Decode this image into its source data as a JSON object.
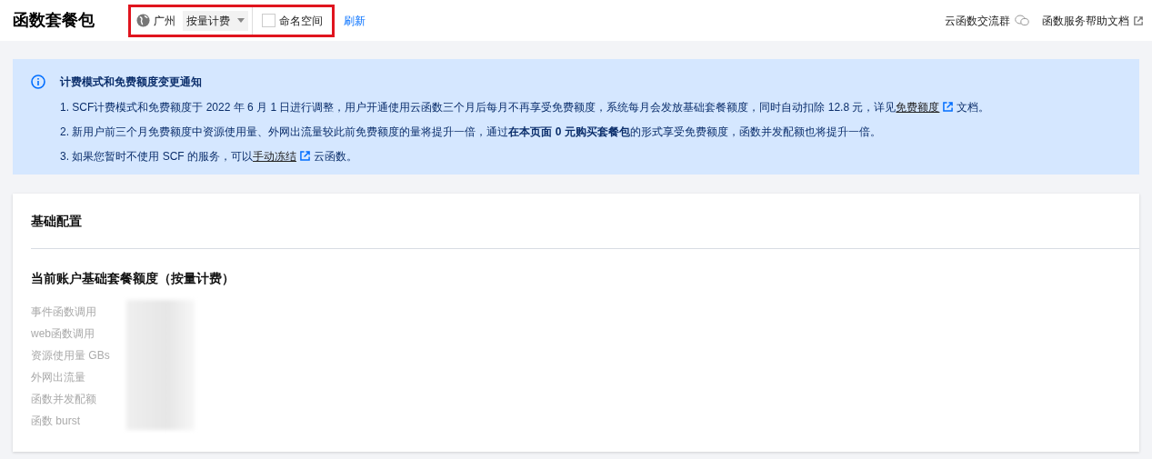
{
  "header": {
    "title": "函数套餐包",
    "region": "广州",
    "billing_mode": "按量计费",
    "namespace": {
      "label": "命名空间",
      "checked": false
    },
    "refresh": "刷新",
    "highlighted": true,
    "links": [
      {
        "label": "云函数交流群",
        "kind": "wechat"
      },
      {
        "label": "函数服务帮助文档",
        "kind": "external"
      }
    ]
  },
  "notice": {
    "title": "计费模式和免费额度变更通知",
    "lines": [
      {
        "before": "1. SCF计费模式和免费额度于 2022 年 6 月 1 日进行调整，用户开通使用云函数三个月后每月不再享受免费额度，系统每月会发放基础套餐额度，同时自动扣除 12.8 元，详见",
        "link": "免费额度",
        "after": "文档。"
      },
      {
        "before": "2. 新用户前三个月免费额度中资源使用量、外网出流量较此前免费额度的量将提升一倍，通过**在本页面 0 元购买套餐包**的形式享受免费额度，函数并发配额也将提升一倍。"
      },
      {
        "before": "3. 如果您暂时不使用 SCF 的服务，可以",
        "link": "手动冻结",
        "after": "云函数。"
      }
    ]
  },
  "card": {
    "title": "基础配置",
    "section": "当前账户基础套餐额度（按量计费）",
    "rows": [
      "事件函数调用",
      "web函数调用",
      "资源使用量 GBs",
      "外网出流量",
      "函数并发配额",
      "函数 burst"
    ]
  }
}
